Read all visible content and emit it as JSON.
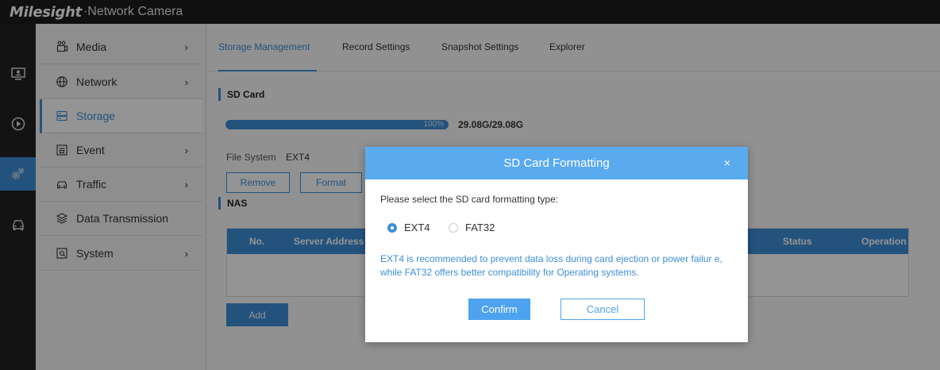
{
  "header": {
    "logo": "Milesight",
    "product": "Network Camera"
  },
  "iconbar": [
    {
      "icon": "monitor-icon"
    },
    {
      "icon": "playback-icon"
    },
    {
      "icon": "settings-icon",
      "active": true
    },
    {
      "icon": "vehicle-icon"
    }
  ],
  "sidebar": {
    "items": [
      {
        "label": "Media",
        "icon": "media-icon",
        "has_arrow": true
      },
      {
        "label": "Network",
        "icon": "network-icon",
        "has_arrow": true
      },
      {
        "label": "Storage",
        "icon": "storage-icon",
        "active": true
      },
      {
        "label": "Event",
        "icon": "event-icon",
        "has_arrow": true
      },
      {
        "label": "Traffic",
        "icon": "traffic-icon",
        "has_arrow": true
      },
      {
        "label": "Data Transmission",
        "icon": "data-transmission-icon"
      },
      {
        "label": "System",
        "icon": "system-icon",
        "has_arrow": true
      }
    ],
    "arrow": "›"
  },
  "tabs": [
    {
      "label": "Storage Management",
      "active": true
    },
    {
      "label": "Record Settings"
    },
    {
      "label": "Snapshot Settings"
    },
    {
      "label": "Explorer"
    }
  ],
  "sd_card": {
    "title": "SD Card",
    "usage_percent": 100,
    "usage_label": "100%",
    "capacity": "29.08G/29.08G",
    "file_system_label": "File System",
    "file_system_value": "EXT4",
    "remove_label": "Remove",
    "format_label": "Format"
  },
  "nas": {
    "title": "NAS",
    "columns": [
      "No.",
      "Server Address",
      "Status",
      "Operation"
    ],
    "rows": [],
    "add_label": "Add"
  },
  "modal": {
    "title": "SD Card Formatting",
    "close": "×",
    "prompt": "Please select the SD card formatting type:",
    "options": [
      {
        "label": "EXT4",
        "selected": true
      },
      {
        "label": "FAT32",
        "selected": false
      }
    ],
    "note": "EXT4 is recommended to prevent data loss during card ejection or power failur e, while FAT32 offers better compatibility for Operating systems.",
    "confirm_label": "Confirm",
    "cancel_label": "Cancel"
  },
  "colors": {
    "accent": "#3d8fd8",
    "modal_header": "#5aaaf0",
    "topbar": "#1d1d1d"
  }
}
